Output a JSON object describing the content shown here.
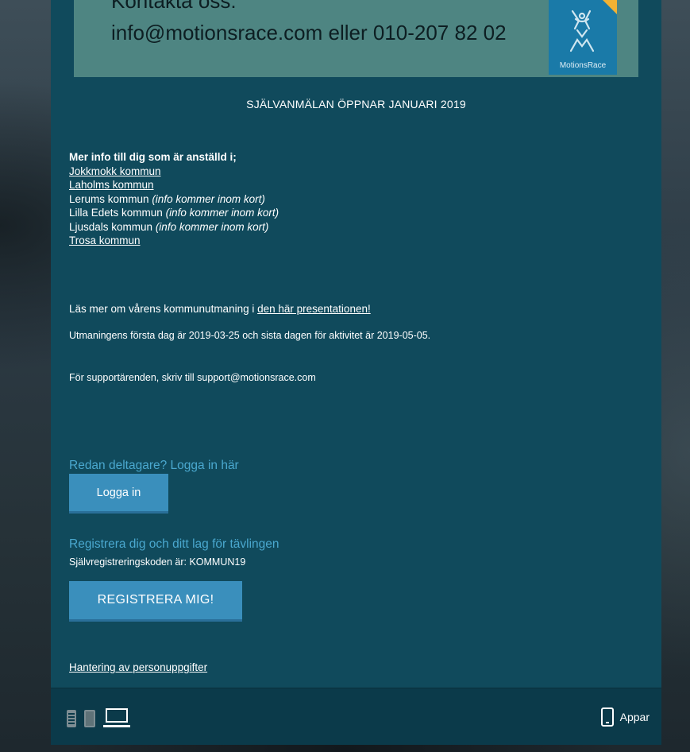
{
  "banner": {
    "line1": "Kontakta oss:",
    "line2": "info@motionsrace.com eller 010-207 82 02",
    "logo_text": "MotionsRace"
  },
  "heading": "SJÄLVANMÄLAN ÖPPNAR JANUARI 2019",
  "info": {
    "intro": "Mer info till dig som är anställd i;",
    "jokkmokk": "Jokkmokk kommun",
    "laholms": "Laholms kommun",
    "lerums": "Lerums kommun",
    "lilla_edets": "Lilla Edets kommun",
    "ljusdals": "Ljusdals kommun",
    "trosa": "Trosa kommun",
    "coming_soon": "(info kommer inom kort)"
  },
  "read_more": {
    "prefix": "Läs mer om vårens kommunutmaning i",
    "link": "den här presentationen!"
  },
  "challenge_dates": "Utmaningens första dag är 2019-03-25 och sista dagen för aktivitet är 2019-05-05.",
  "support": "För supportärenden, skriv till support@motionsrace.com",
  "login": {
    "title": "Redan deltagare? Logga in här",
    "button": "Logga in"
  },
  "register": {
    "title": "Registrera dig och ditt lag för tävlingen",
    "code_text": "Självregistreringskoden är: KOMMUN19",
    "button": "REGISTRERA MIG!"
  },
  "privacy_link": "Hantering av personuppgifter",
  "footer": {
    "apps_label": "Appar",
    "icons": [
      "phone-small-icon",
      "tablet-icon",
      "laptop-icon",
      "mobile-app-icon"
    ]
  },
  "colors": {
    "panel": "#104a5c",
    "banner": "#4e8582",
    "accent_title": "#4aa8cf",
    "button": "#3a8fbc"
  }
}
